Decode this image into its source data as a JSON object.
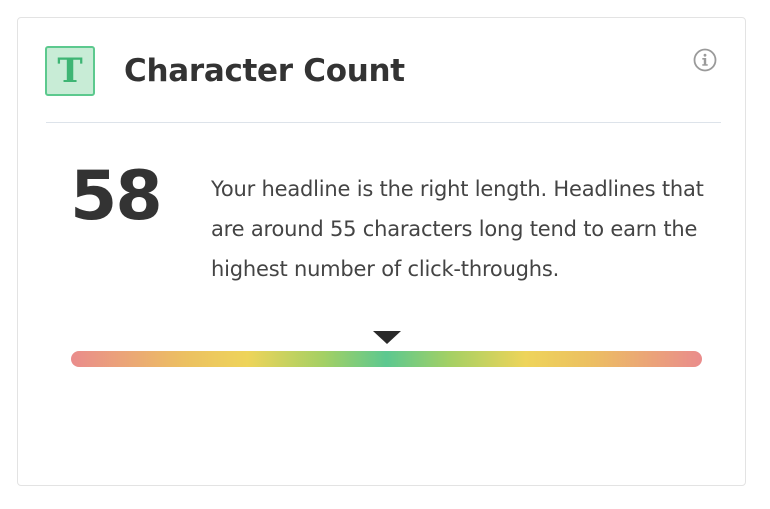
{
  "widget": {
    "icon_letter": "T",
    "title": "Character Count",
    "info_icon": "info-circle-icon"
  },
  "result": {
    "count": "58",
    "message": "Your headline is the right length. Headlines that are around 55 characters long tend to earn the highest number of click-throughs."
  },
  "meter": {
    "marker_position_fraction": 0.5,
    "colors": {
      "ends": "#ea8c8c",
      "middle_yellow": "#eed45a",
      "center_green": "#5cc890"
    }
  },
  "colors": {
    "accent_green": "#3eb574",
    "text_dark": "#333333",
    "border": "#e3e3e3"
  }
}
